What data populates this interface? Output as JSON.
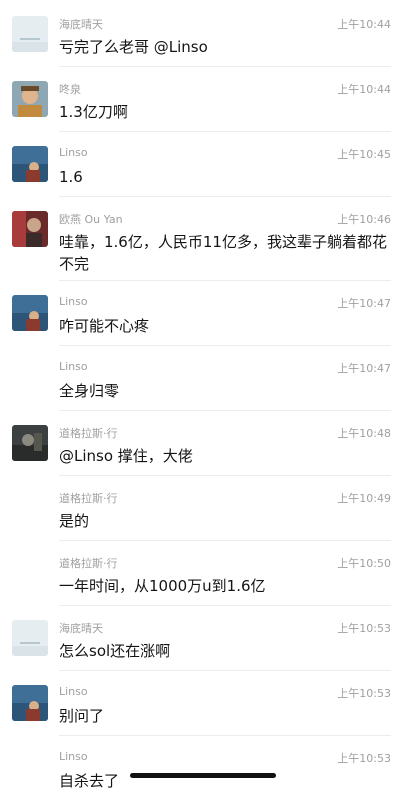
{
  "messages": [
    {
      "sender": "海底晴天",
      "time": "上午10:44",
      "text": "亏完了么老哥 @Linso",
      "avatar": "avatar-light"
    },
    {
      "sender": "咚泉",
      "time": "上午10:44",
      "text": "1.3亿刀啊",
      "avatar": "avatar-portrait"
    },
    {
      "sender": "Linso",
      "time": "上午10:45",
      "text": "1.6",
      "avatar": "avatar-lake"
    },
    {
      "sender": "欧燕 Ou Yan",
      "time": "上午10:46",
      "text": "哇靠，1.6亿，人民币11亿多，我这辈子躺着都花不完",
      "avatar": "avatar-red"
    },
    {
      "sender": "Linso",
      "time": "上午10:47",
      "text": "咋可能不心疼",
      "avatar": "avatar-lake"
    },
    {
      "sender": "Linso",
      "time": "上午10:47",
      "text": "全身归零",
      "avatar": ""
    },
    {
      "sender": "道格拉斯·行",
      "time": "上午10:48",
      "text": "@Linso 撑住，大佬",
      "avatar": "avatar-dark"
    },
    {
      "sender": "道格拉斯·行",
      "time": "上午10:49",
      "text": "是的",
      "avatar": ""
    },
    {
      "sender": "道格拉斯·行",
      "time": "上午10:50",
      "text": "一年时间，从1000万u到1.6亿",
      "avatar": ""
    },
    {
      "sender": "海底晴天",
      "time": "上午10:53",
      "text": "怎么sol还在涨啊",
      "avatar": "avatar-light"
    },
    {
      "sender": "Linso",
      "time": "上午10:53",
      "text": "别问了",
      "avatar": "avatar-lake"
    },
    {
      "sender": "Linso",
      "time": "上午10:53",
      "text": "自杀去了",
      "avatar": ""
    }
  ]
}
